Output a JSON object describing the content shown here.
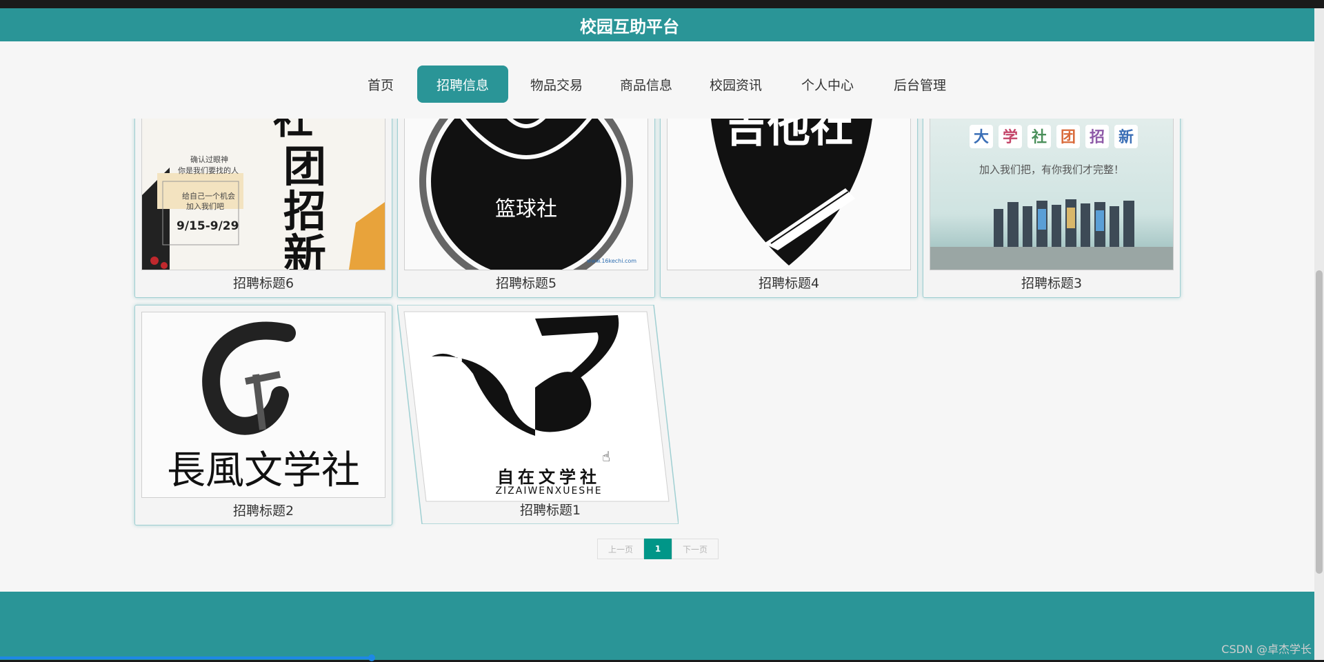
{
  "header": {
    "title": "校园互助平台"
  },
  "nav": {
    "items": [
      {
        "label": "首页"
      },
      {
        "label": "招聘信息"
      },
      {
        "label": "物品交易"
      },
      {
        "label": "商品信息"
      },
      {
        "label": "校园资讯"
      },
      {
        "label": "个人中心"
      },
      {
        "label": "后台管理"
      }
    ]
  },
  "cards": [
    {
      "title": "招聘标题6",
      "img": {
        "l1": "确认过眼神",
        "l2": "你是我们要找的人",
        "big1": "社",
        "big2": "团",
        "big3": "招",
        "big4": "新",
        "note": "给自己一个机会",
        "note2": "加入我们吧",
        "date": "9/15-9/29"
      }
    },
    {
      "title": "招聘标题5",
      "img": {
        "name": "篮球社",
        "site": "www.16kechi.com"
      }
    },
    {
      "title": "招聘标题4",
      "img": {
        "name": "吉他社"
      }
    },
    {
      "title": "招聘标题3",
      "img": {
        "chars": [
          "大",
          "学",
          "社",
          "团",
          "招",
          "新"
        ],
        "slogan": "加入我们把，有你我们才完整！"
      }
    },
    {
      "title": "招聘标题2",
      "img": {
        "name": "長風文学社"
      }
    },
    {
      "title": "招聘标题1",
      "img": {
        "name": "自在文学社",
        "pinyin": "ZIZAIWENXUESHE"
      }
    }
  ],
  "pager": {
    "prev": "上一页",
    "current": "1",
    "next": "下一页"
  },
  "watermark": "CSDN @卓杰学长",
  "colors": {
    "accent": "#2a9597",
    "page_active": "#009688"
  }
}
